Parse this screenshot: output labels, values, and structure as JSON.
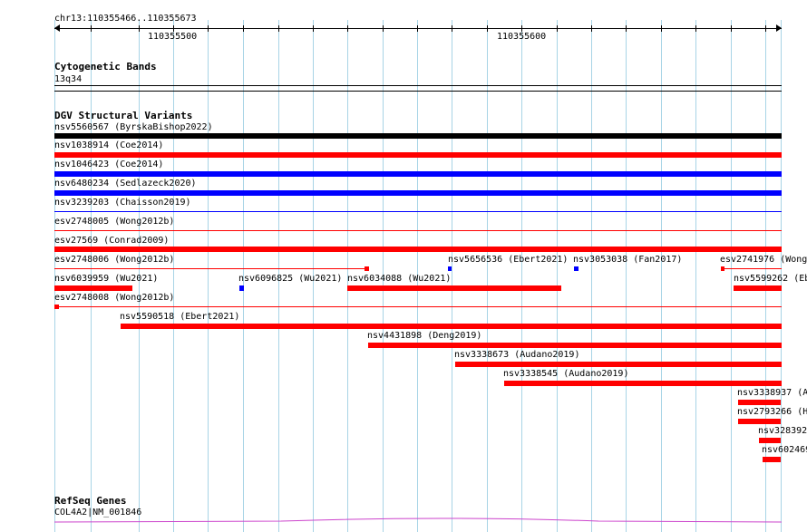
{
  "ruler": {
    "location": "chr13:110355466..110355673",
    "tick_a": "110355500",
    "tick_b": "110355600"
  },
  "cytoband": {
    "title": "Cytogenetic Bands",
    "band": "13q34"
  },
  "dgv": {
    "title": "DGV Structural Variants",
    "variants": [
      {
        "label": "nsv5560567 (ByrskaBishop2022)",
        "color": "#000000"
      },
      {
        "label": "nsv1038914 (Coe2014)",
        "color": "#ff0000"
      },
      {
        "label": "nsv1046423 (Coe2014)",
        "color": "#0000ff"
      },
      {
        "label": "nsv6480234 (Sedlazeck2020)",
        "color": "#0000ff"
      },
      {
        "label": "nsv3239203 (Chaisson2019)",
        "color": "#0000ff"
      },
      {
        "label": "esv2748005 (Wong2012b)",
        "color": "#ff0000"
      },
      {
        "label": "esv27569 (Conrad2009)",
        "color": "#ff0000"
      },
      {
        "label": "esv2748006 (Wong2012b)",
        "color": "#ff0000"
      },
      {
        "label": "nsv5656536 (Ebert2021)",
        "color": "#0000ff"
      },
      {
        "label": "nsv3053038 (Fan2017)",
        "color": "#0000ff"
      },
      {
        "label": "esv2741976 (Wong",
        "color": "#ff0000"
      },
      {
        "label": "nsv6039959 (Wu2021)",
        "color": "#ff0000"
      },
      {
        "label": "nsv6096825 (Wu2021)",
        "color": "#0000ff"
      },
      {
        "label": "nsv6034088 (Wu2021)",
        "color": "#ff0000"
      },
      {
        "label": "nsv5599262 (Eb",
        "color": "#ff0000"
      },
      {
        "label": "esv2748008 (Wong2012b)",
        "color": "#ff0000"
      },
      {
        "label": "nsv5590518 (Ebert2021)",
        "color": "#ff0000"
      },
      {
        "label": "nsv4431898 (Deng2019)",
        "color": "#ff0000"
      },
      {
        "label": "nsv3338673 (Audano2019)",
        "color": "#ff0000"
      },
      {
        "label": "nsv3338545 (Audano2019)",
        "color": "#ff0000"
      },
      {
        "label": "nsv3338937 (A",
        "color": "#ff0000"
      },
      {
        "label": "nsv2793266 (H",
        "color": "#ff0000"
      },
      {
        "label": "nsv328392",
        "color": "#ff0000"
      },
      {
        "label": "nsv602469",
        "color": "#ff0000"
      }
    ]
  },
  "refseq": {
    "title": "RefSeq Genes",
    "gene": "COL4A2|NM_001846",
    "color": "#cc44cc"
  }
}
